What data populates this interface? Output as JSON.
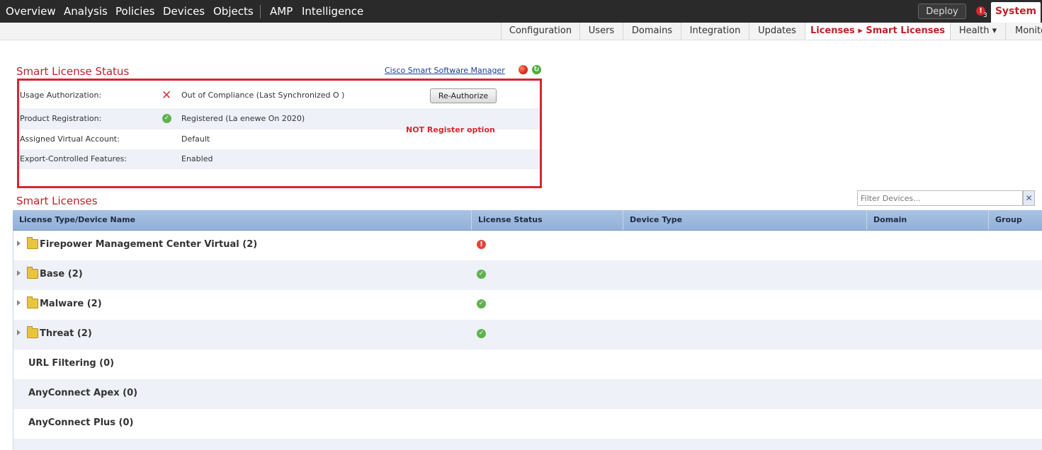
{
  "topnav": {
    "items": [
      "Overview",
      "Analysis",
      "Policies",
      "Devices",
      "Objects",
      "AMP",
      "Intelligence"
    ],
    "deploy_label": "Deploy",
    "alert_count": "3",
    "system_label": "System"
  },
  "subnav": {
    "items": [
      "Configuration",
      "Users",
      "Domains",
      "Integration",
      "Updates",
      "Licenses ▸ Smart Licenses",
      "Health ▾",
      "Monito"
    ],
    "active_index": 5
  },
  "status": {
    "title": "Smart License Status",
    "cssm_link": "Cisco Smart Software Manager",
    "rows": [
      {
        "label": "Usage Authorization:",
        "value": "Out of Compliance (Last Synchronized O          )",
        "icon": "x-icon"
      },
      {
        "label": "Product Registration:",
        "value": "Registered (La    enewe   On          2020)",
        "icon": "check-circle-icon"
      },
      {
        "label": "Assigned Virtual Account:",
        "value": "Default"
      },
      {
        "label": "Export-Controlled Features:",
        "value": "Enabled"
      }
    ],
    "reauthorize_label": "Re-Authorize",
    "annotation": "NOT Register option"
  },
  "smart_licenses": {
    "title": "Smart Licenses",
    "filter_placeholder": "Filter Devices...",
    "filter_clear": "✕",
    "columns": [
      "License Type/Device Name",
      "License Status",
      "Device Type",
      "Domain",
      "Group"
    ],
    "rows": [
      {
        "name": "Firepower Management Center Virtual (2)",
        "status": "error",
        "expandable": true
      },
      {
        "name": "Base (2)",
        "status": "ok",
        "expandable": true
      },
      {
        "name": "Malware (2)",
        "status": "ok",
        "expandable": true
      },
      {
        "name": "Threat (2)",
        "status": "ok",
        "expandable": true
      },
      {
        "name": "URL Filtering (0)",
        "status": "",
        "expandable": false
      },
      {
        "name": "AnyConnect Apex (0)",
        "status": "",
        "expandable": false
      },
      {
        "name": "AnyConnect Plus (0)",
        "status": "",
        "expandable": false
      }
    ]
  },
  "colors": {
    "accent_red": "#c0202a",
    "nav_bg": "#2a2a2a",
    "table_header": "#a9c2e3",
    "ok_green": "#5fb24f",
    "error_red": "#e0463a"
  }
}
